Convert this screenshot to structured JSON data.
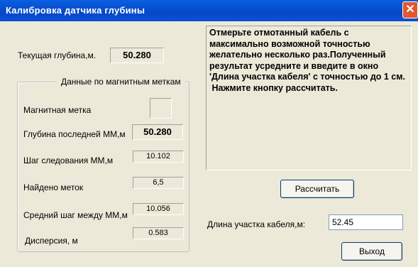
{
  "window": {
    "title": "Калибровка датчика глубины",
    "close_symbol": "✕"
  },
  "current_depth": {
    "label": "Текущая глубина,м.",
    "value": "50.280"
  },
  "magnetic_group": {
    "title": "Данные по магнитным меткам",
    "magnetic_mark_label": "Магнитная метка",
    "last_mm_depth_label": "Глубина последней ММ,м",
    "last_mm_depth_value": "50.280",
    "mm_step_label": "Шаг следования ММ,м",
    "mm_step_value": "10.102",
    "found_marks_label": "Найдено меток",
    "found_marks_value": "6,5",
    "avg_step_label": "Средний шаг между ММ,м",
    "avg_step_value": "10.056",
    "dispersion_label": "Дисперсия, м",
    "dispersion_value": "0.583"
  },
  "instructions": {
    "text": "Отмерьте отмотанный кабель с максимально возможной точностью желательно несколько раз.Полученный результат усредните и введите в окно 'Длина участка кабеля' с точностью до 1 см.\n Нажмите кнопку рассчитать."
  },
  "calculate_button": {
    "label": "Рассчитать"
  },
  "cable_length": {
    "label": "Длина участка кабеля,м:",
    "value": "52.45"
  },
  "exit_button": {
    "label": "Выход"
  }
}
